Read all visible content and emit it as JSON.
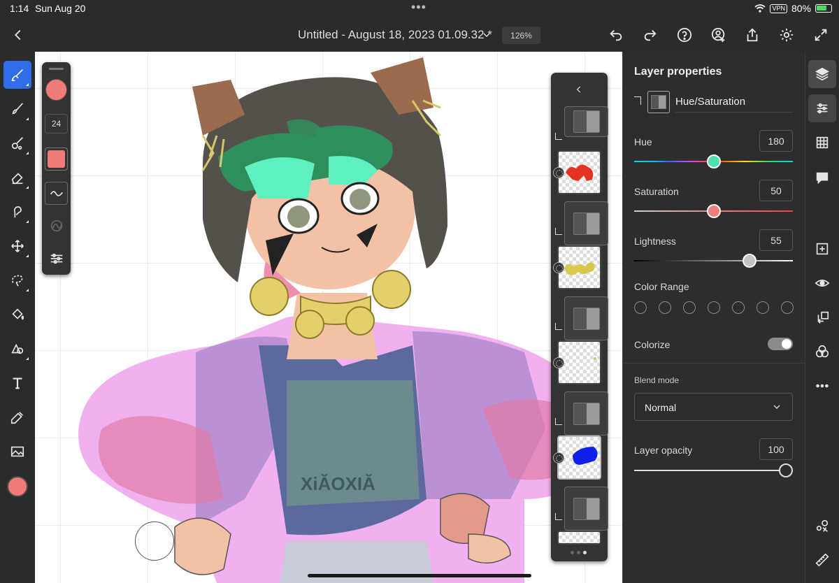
{
  "status_bar": {
    "time": "1:14",
    "date": "Sun Aug 20",
    "vpn": "VPN",
    "battery": "80%"
  },
  "top_bar": {
    "document_title": "Untitled - August 18, 2023 01.09.32 *",
    "zoom": "126%",
    "icons": [
      "back-icon",
      "chevron-down-icon",
      "undo-icon",
      "redo-icon",
      "help-icon",
      "invite-icon",
      "share-icon",
      "settings-icon",
      "fullscreen-icon"
    ]
  },
  "left_toolbar": {
    "tools": [
      "brush-tool",
      "paint-brush-tool",
      "watercolor-tool",
      "eraser-tool",
      "smudge-tool",
      "move-tool",
      "lasso-select-tool",
      "fill-tool",
      "shape-tool",
      "text-tool",
      "eyedropper-tool",
      "image-tool"
    ],
    "active_tool": "brush-tool",
    "current_color": "#f17b77"
  },
  "brush_panel": {
    "color": "#f17b77",
    "size": "24"
  },
  "layers_panel": {
    "layers": [
      {
        "type": "adjustment",
        "clipped": true
      },
      {
        "type": "pixel",
        "content": "red shape",
        "has_mask": true
      },
      {
        "type": "adjustment",
        "clipped": true
      },
      {
        "type": "pixel",
        "content": "yellow shape",
        "has_mask": true
      },
      {
        "type": "adjustment",
        "clipped": true
      },
      {
        "type": "pixel",
        "content": "sparse yellow",
        "has_mask": true
      },
      {
        "type": "adjustment",
        "clipped": true
      },
      {
        "type": "pixel",
        "content": "blue shape",
        "has_mask": true,
        "selected": true
      },
      {
        "type": "adjustment",
        "clipped": true
      },
      {
        "type": "pixel",
        "content": "partial"
      }
    ],
    "pages": 3,
    "current_page": 3
  },
  "properties": {
    "title": "Layer properties",
    "adjustment_name": "Hue/Saturation",
    "hue": {
      "label": "Hue",
      "value": "180",
      "fraction": 0.5
    },
    "saturation": {
      "label": "Saturation",
      "value": "50",
      "fraction": 0.5
    },
    "lightness": {
      "label": "Lightness",
      "value": "55",
      "fraction": 0.75
    },
    "color_range": {
      "label": "Color Range",
      "options": 7
    },
    "colorize": {
      "label": "Colorize",
      "on": true
    },
    "blend_mode": {
      "label": "Blend mode",
      "value": "Normal"
    },
    "opacity": {
      "label": "Layer opacity",
      "value": "100",
      "fraction": 1.0
    }
  },
  "right_rail": {
    "icons": [
      "layers-icon",
      "adjustments-icon",
      "grid-icon",
      "comments-icon",
      "add-layer-icon",
      "visibility-icon",
      "clip-layer-icon",
      "blend-icon",
      "more-icon",
      "liquify-icon",
      "ruler-icon"
    ],
    "selected": "adjustments-icon"
  },
  "colors": {
    "accent": "#2f6ee8",
    "panel_bg": "#2d2d2d",
    "brush_color": "#f17b77"
  }
}
